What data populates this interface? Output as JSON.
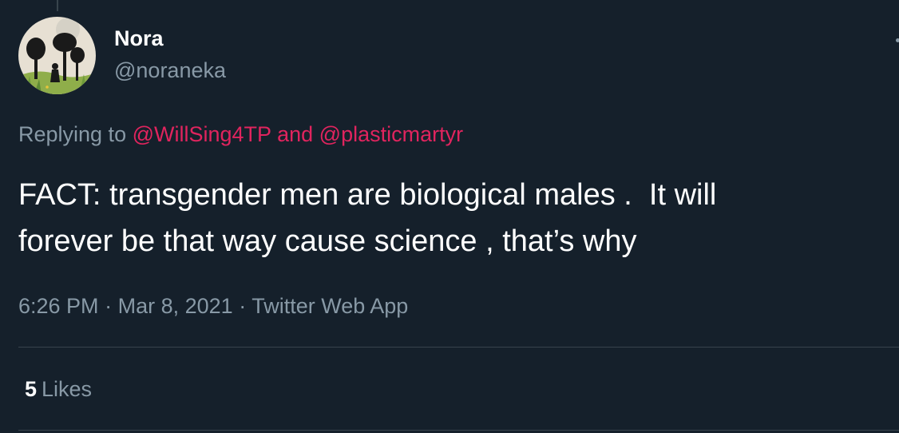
{
  "user": {
    "display_name": "Nora",
    "handle": "@noraneka"
  },
  "reply": {
    "prefix": "Replying to",
    "mention_1": "@WillSing4TP",
    "conjunction": "and",
    "mention_2": "@plasticmartyr"
  },
  "tweet": {
    "text": "FACT: transgender men are biological males .  It will\nforever be that way cause science , that’s why"
  },
  "meta": {
    "time": "6:26 PM",
    "separator": "·",
    "date": "Mar 8, 2021",
    "source": "Twitter Web App"
  },
  "stats": {
    "likes_count": "5",
    "likes_label": "Likes"
  },
  "colors": {
    "background": "#15202b",
    "text_primary": "#ffffff",
    "text_secondary": "#8899a6",
    "mention": "#e0245e",
    "divider": "#38444d"
  },
  "icons": {
    "more": "more-icon"
  }
}
